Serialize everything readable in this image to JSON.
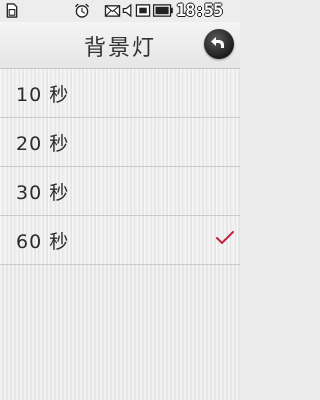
{
  "status_bar": {
    "time": "18:55",
    "icons": [
      "sim-icon",
      "alarm-icon",
      "message-icon",
      "volume-icon",
      "memory-card-icon",
      "battery-icon"
    ]
  },
  "header": {
    "title": "背景灯",
    "back_icon": "back-arrow-icon"
  },
  "options": [
    {
      "label": "10 秒",
      "selected": false
    },
    {
      "label": "20 秒",
      "selected": false
    },
    {
      "label": "30 秒",
      "selected": false
    },
    {
      "label": "60 秒",
      "selected": true
    }
  ],
  "colors": {
    "check_accent": "#c3243f"
  }
}
